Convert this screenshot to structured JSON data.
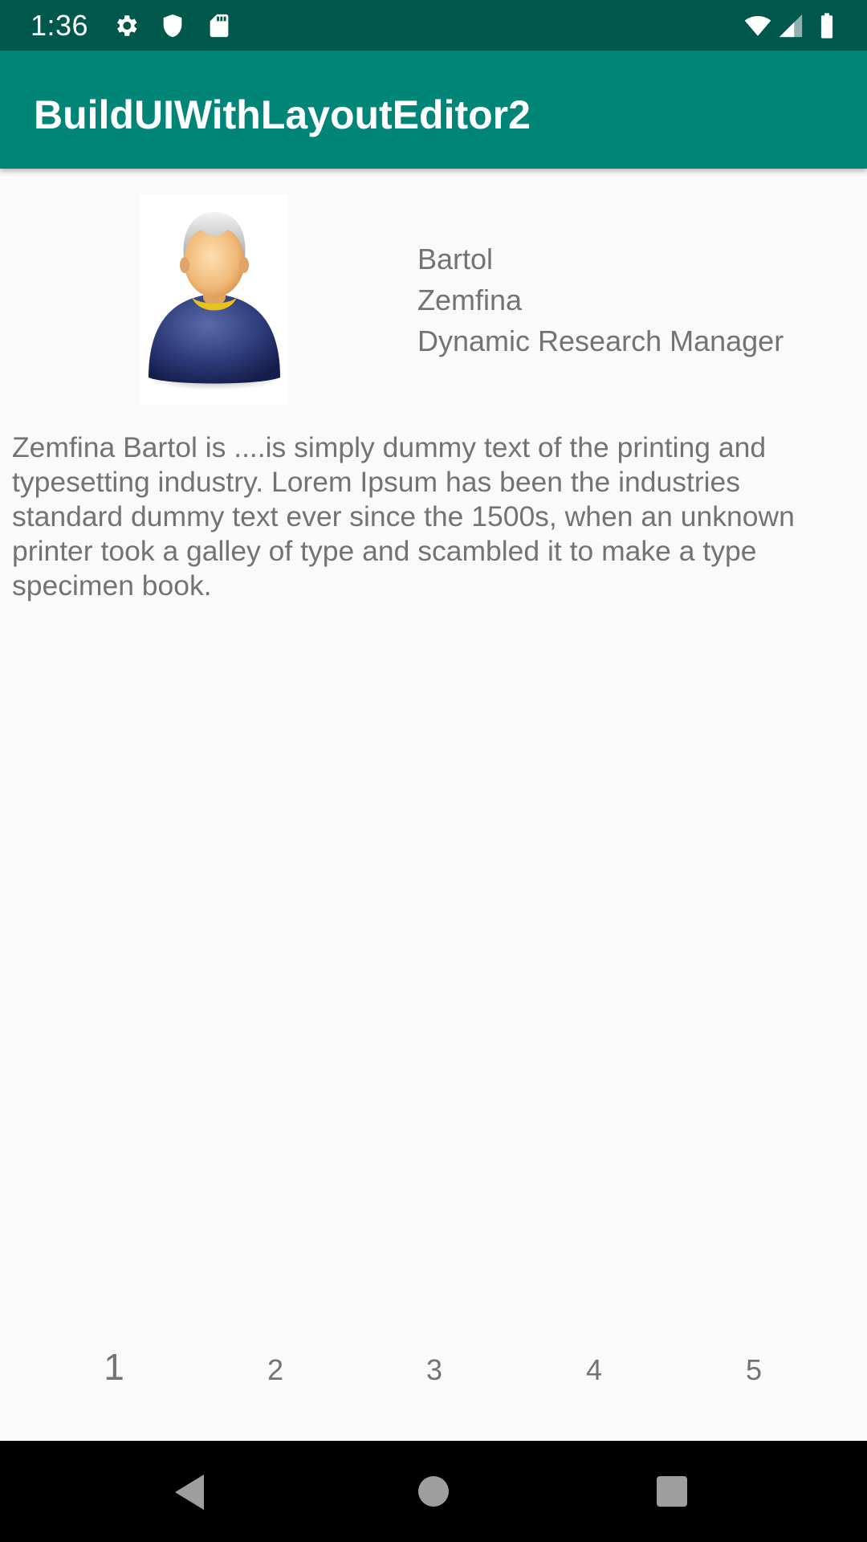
{
  "status_bar": {
    "time": "1:36",
    "icons": [
      "gear-icon",
      "shield-icon",
      "sd-card-icon",
      "wifi-icon",
      "cell-signal-icon",
      "battery-icon"
    ]
  },
  "app_bar": {
    "title": "BuildUIWithLayoutEditor2",
    "color": "#008577"
  },
  "profile": {
    "avatar_icon": "person-avatar-icon",
    "last_name": "Bartol",
    "first_name": "Zemfina",
    "job_title": "Dynamic Research Manager",
    "bio": "Zemfina Bartol is ....is simply dummy text of the printing and typesetting industry. Lorem Ipsum has been the industries standard dummy text ever since the 1500s, when an unknown printer took a galley of type and scambled it to make a type specimen book."
  },
  "pager": {
    "pages": [
      "1",
      "2",
      "3",
      "4",
      "5"
    ]
  },
  "nav_bar": {
    "icons": [
      "back-icon",
      "home-icon",
      "recents-icon"
    ]
  }
}
